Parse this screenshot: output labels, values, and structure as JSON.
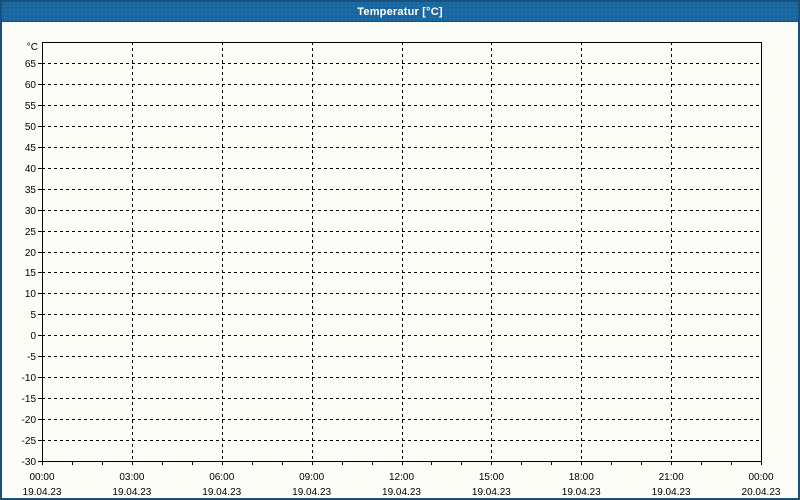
{
  "window": {
    "title": "Temperatur [°C]",
    "title_bar_color": "#1d6aa4",
    "border_color": "#17527e",
    "background_color": "#fcfdf7"
  },
  "chart_data": {
    "type": "line",
    "title": "Temperatur [°C]",
    "series": [],
    "grid": "dashed",
    "gridline_color": "#000000",
    "axis_color": "#000000",
    "y_axis": {
      "unit_label": "°C",
      "min": -30,
      "max": 70,
      "tick_step": 5,
      "tick_labels": [
        65,
        60,
        55,
        50,
        45,
        40,
        35,
        30,
        25,
        20,
        15,
        10,
        5,
        0,
        -5,
        -10,
        -15,
        -20,
        -25,
        -30
      ]
    },
    "x_axis": {
      "span_hours": 24,
      "minor_tick_hours": 1,
      "major_tick_hours": 3,
      "tick_labels": [
        {
          "hour": 0,
          "time": "00:00",
          "date": "19.04.23"
        },
        {
          "hour": 3,
          "time": "03:00",
          "date": "19.04.23"
        },
        {
          "hour": 6,
          "time": "06:00",
          "date": "19.04.23"
        },
        {
          "hour": 9,
          "time": "09:00",
          "date": "19.04.23"
        },
        {
          "hour": 12,
          "time": "12:00",
          "date": "19.04.23"
        },
        {
          "hour": 15,
          "time": "15:00",
          "date": "19.04.23"
        },
        {
          "hour": 18,
          "time": "18:00",
          "date": "19.04.23"
        },
        {
          "hour": 21,
          "time": "21:00",
          "date": "19.04.23"
        },
        {
          "hour": 24,
          "time": "00:00",
          "date": "20.04.23"
        }
      ]
    }
  }
}
